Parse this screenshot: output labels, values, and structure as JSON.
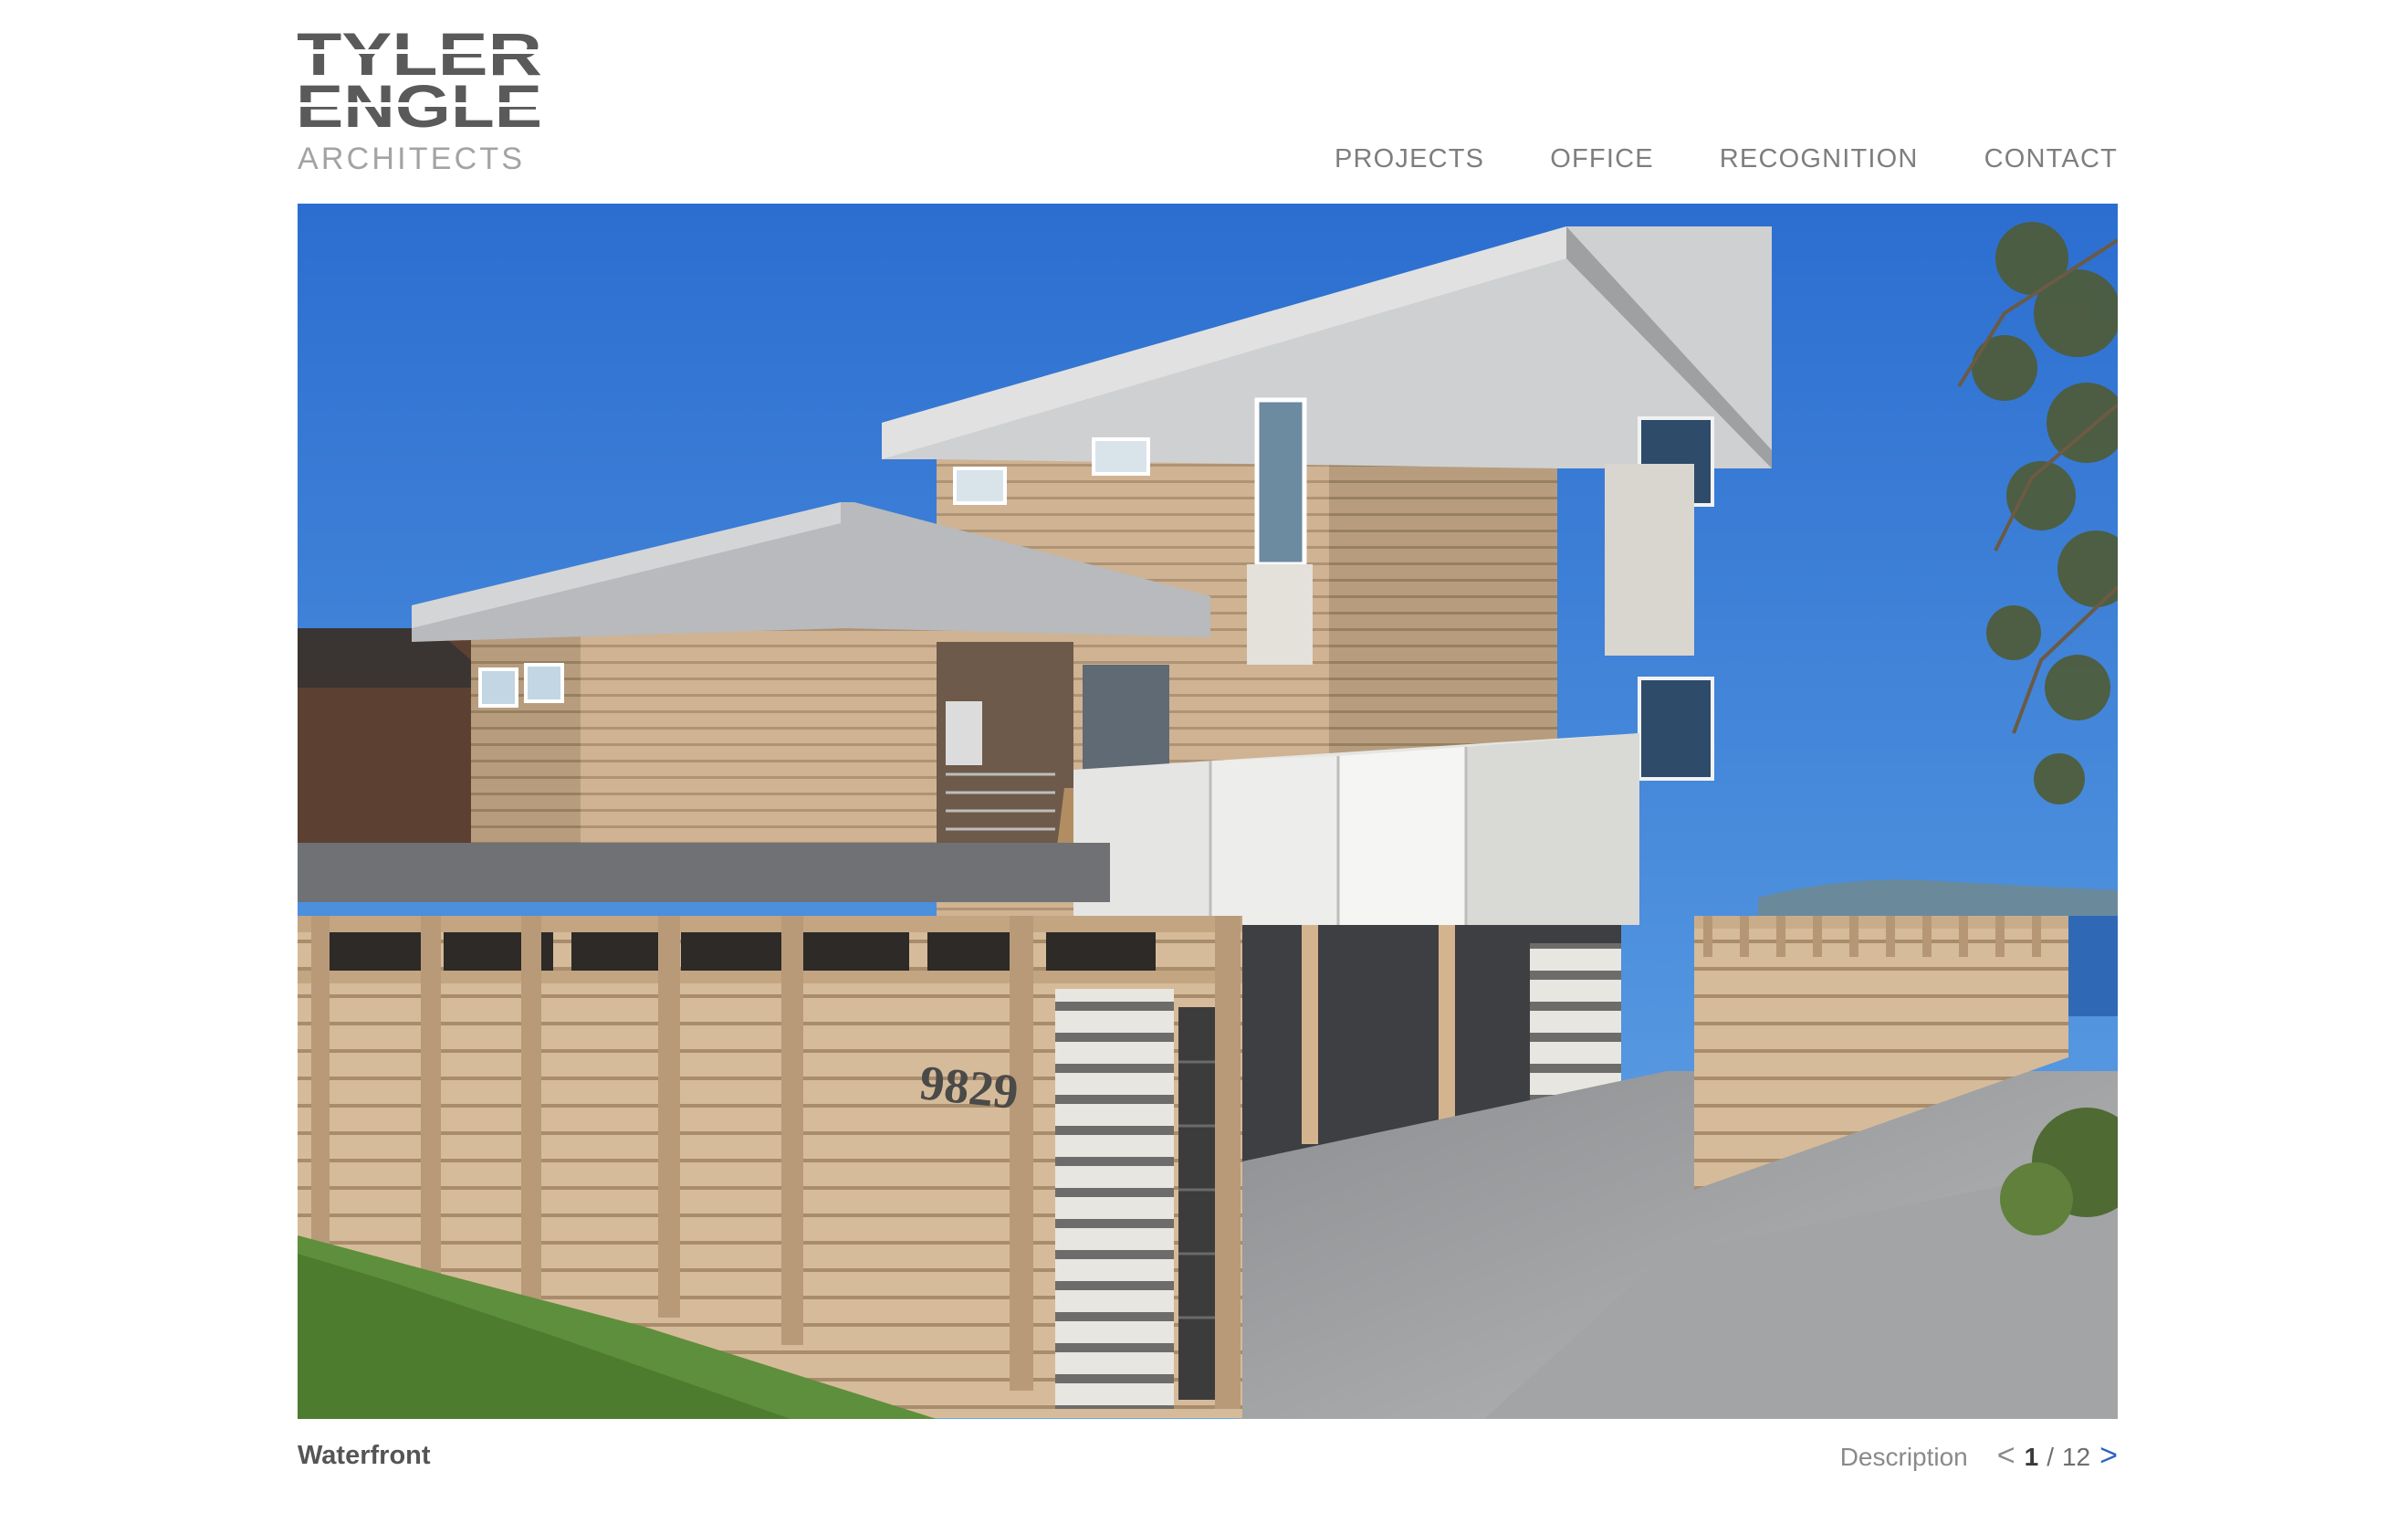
{
  "logo": {
    "line1": "TYLER",
    "line2": "ENGLE",
    "subtitle": "ARCHITECTS"
  },
  "nav": {
    "items": [
      {
        "label": "PROJECTS"
      },
      {
        "label": "OFFICE"
      },
      {
        "label": "RECOGNITION"
      },
      {
        "label": "CONTACT"
      }
    ]
  },
  "hero": {
    "house_number": "9829"
  },
  "caption": {
    "project_title": "Waterfront",
    "description_label": "Description",
    "prev_symbol": "<",
    "next_symbol": ">",
    "current": "1",
    "separator": "/",
    "total": "12"
  },
  "colors": {
    "nav_text": "#7e7e7e",
    "logo_gray": "#a3a3a3",
    "logo_dark": "#555555",
    "next_arrow": "#2b63c4",
    "sky": "#3d7fd0"
  }
}
